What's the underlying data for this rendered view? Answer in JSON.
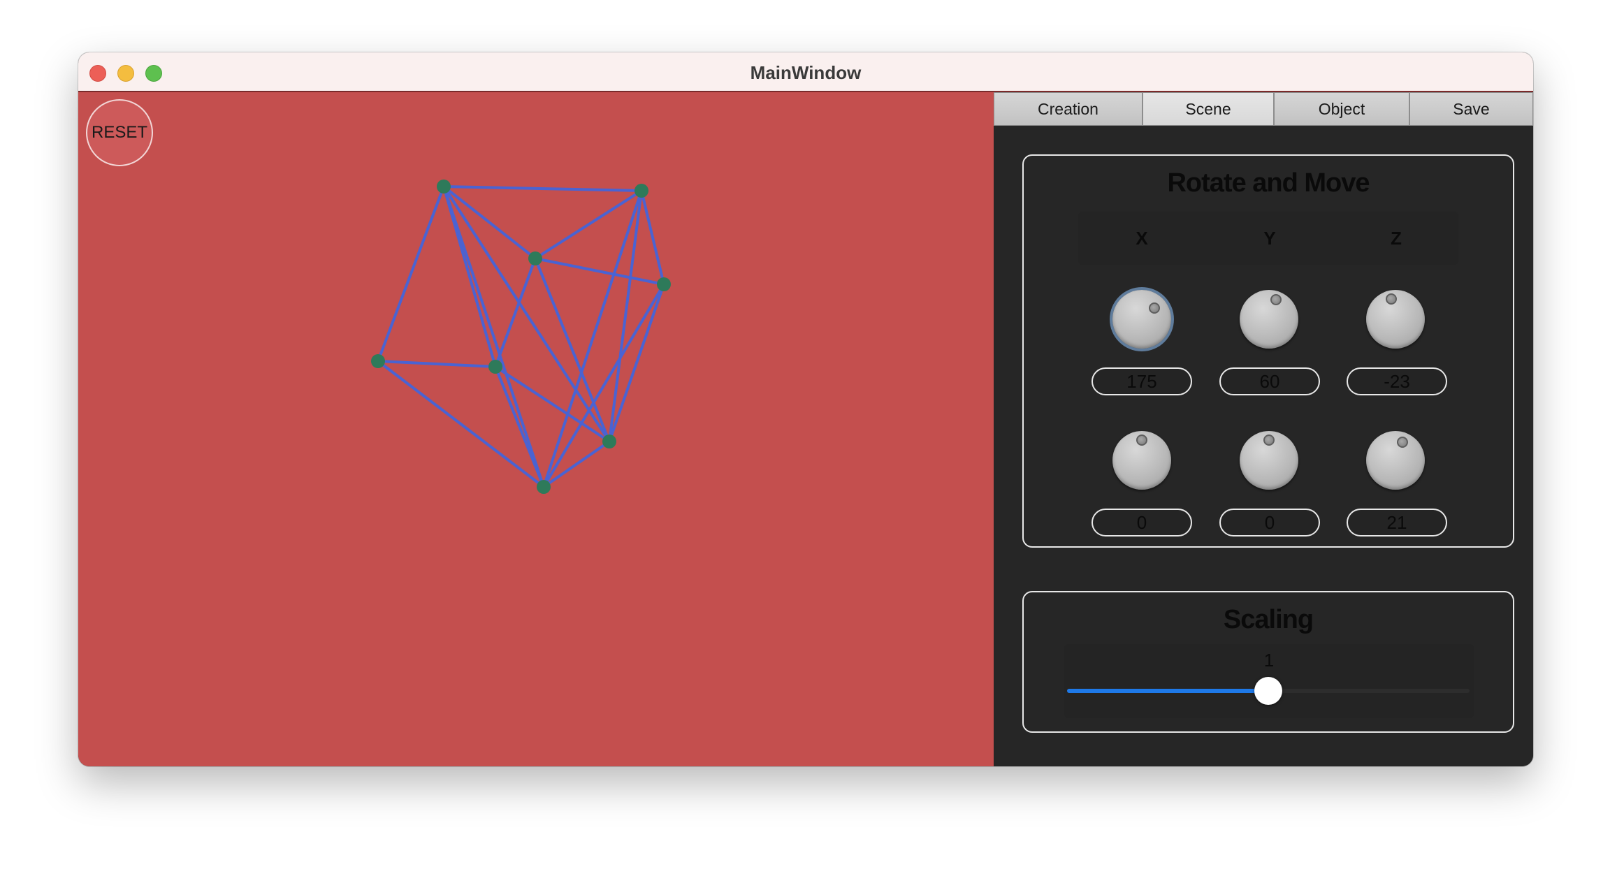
{
  "window": {
    "title": "MainWindow"
  },
  "canvas": {
    "reset_label": "RESET",
    "background_color": "#c44f4e",
    "edge_color": "#4a63d2",
    "vertex_color": "#2e7a5a"
  },
  "tabs": [
    {
      "label": "Creation",
      "active": false
    },
    {
      "label": "Scene",
      "active": true
    },
    {
      "label": "Object",
      "active": false
    },
    {
      "label": "Save",
      "active": false
    }
  ],
  "rotate_move": {
    "title": "Rotate and Move",
    "axes": [
      "X",
      "Y",
      "Z"
    ],
    "rotation_values": [
      "175",
      "60",
      "-23"
    ],
    "move_values": [
      "0",
      "0",
      "21"
    ]
  },
  "scaling": {
    "title": "Scaling",
    "value": "1",
    "fraction": 0.5,
    "accent_color": "#1e79e8"
  }
}
